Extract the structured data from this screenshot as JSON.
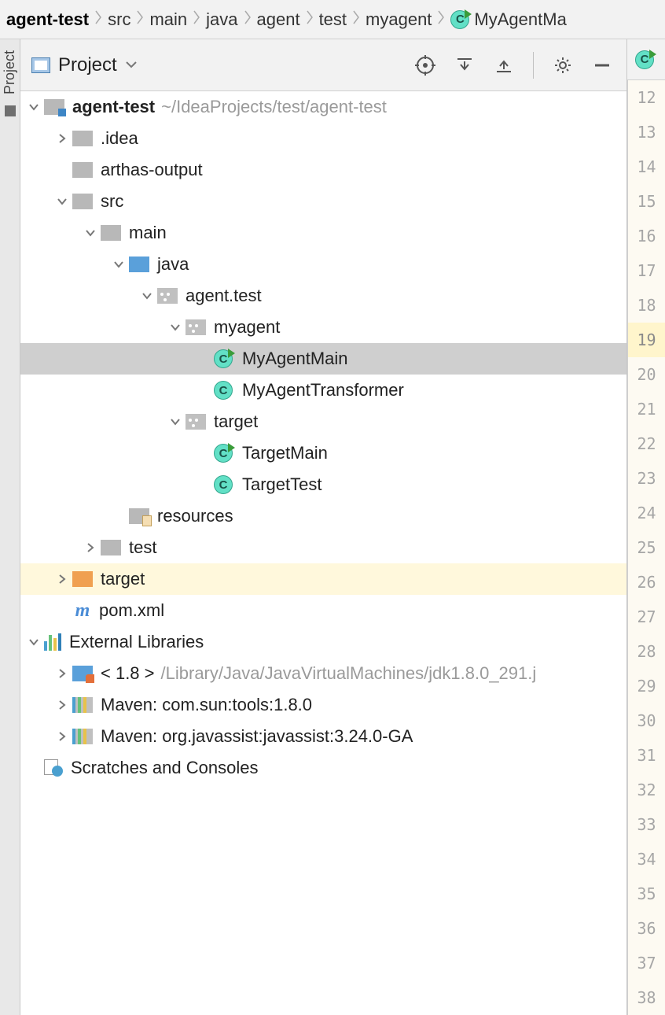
{
  "breadcrumbs": {
    "items": [
      "agent-test",
      "src",
      "main",
      "java",
      "agent",
      "test",
      "myagent",
      "MyAgentMa"
    ]
  },
  "panel": {
    "title": "Project"
  },
  "toolbar": {
    "select_opened": "Select Opened File",
    "expand_all": "Expand All",
    "collapse_all": "Collapse All",
    "settings": "Settings",
    "hide": "Hide"
  },
  "tree": {
    "project_name": "agent-test",
    "project_path": "~/IdeaProjects/test/agent-test",
    "idea": ".idea",
    "arthas_output": "arthas-output",
    "src": "src",
    "main": "main",
    "java": "java",
    "pkg_agent_test": "agent.test",
    "pkg_myagent": "myagent",
    "cls_myagentmain": "MyAgentMain",
    "cls_myagenttransformer": "MyAgentTransformer",
    "pkg_target": "target",
    "cls_targetmain": "TargetMain",
    "cls_targettest": "TargetTest",
    "resources": "resources",
    "test": "test",
    "target_dir": "target",
    "pom": "pom.xml",
    "external_libraries": "External Libraries",
    "jdk_label": "< 1.8 >",
    "jdk_path": "/Library/Java/JavaVirtualMachines/jdk1.8.0_291.j",
    "maven_tools": "Maven: com.sun:tools:1.8.0",
    "maven_javassist": "Maven: org.javassist:javassist:3.24.0-GA",
    "scratches": "Scratches and Consoles"
  },
  "gutter": {
    "start": 12,
    "end": 38,
    "current": 19
  }
}
